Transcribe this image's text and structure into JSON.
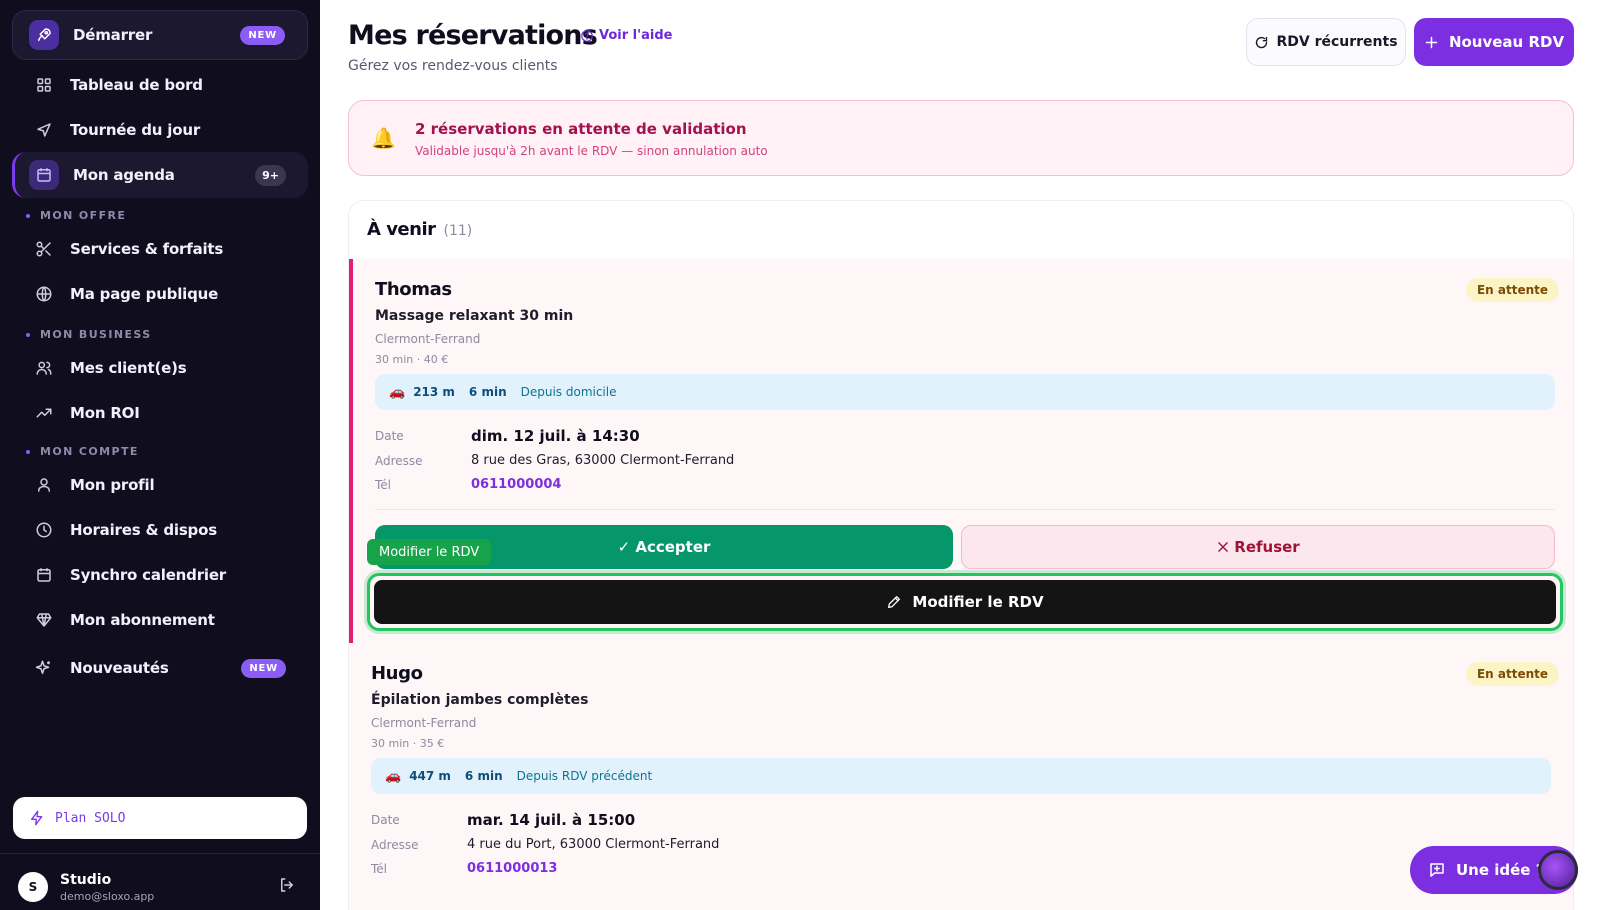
{
  "sidebar": {
    "start": {
      "label": "Démarrer",
      "badge": "NEW"
    },
    "items": [
      {
        "label": "Tableau de bord"
      },
      {
        "label": "Tournée du jour"
      },
      {
        "label": "Mon agenda",
        "badge": "9+"
      }
    ],
    "sections": {
      "offre": {
        "title": "MON OFFRE",
        "items": [
          "Services & forfaits",
          "Ma page publique"
        ]
      },
      "business": {
        "title": "MON BUSINESS",
        "items": [
          "Mes client(e)s",
          "Mon ROI"
        ]
      },
      "compte": {
        "title": "MON COMPTE",
        "items": [
          "Mon profil",
          "Horaires & dispos",
          "Synchro calendrier",
          "Mon abonnement"
        ]
      }
    },
    "news": {
      "label": "Nouveautés",
      "badge": "NEW"
    },
    "plan": "Plan SOLO",
    "user": {
      "initial": "S",
      "name": "Studio",
      "email": "demo@sloxo.app"
    }
  },
  "header": {
    "title": "Mes réservations",
    "help": "Voir l'aide",
    "subtitle": "Gérez vos rendez-vous clients",
    "recurrent_button": "RDV récurrents",
    "new_button": "Nouveau RDV"
  },
  "alert": {
    "title": "2 réservations en attente de validation",
    "subtitle": "Validable jusqu'à 2h avant le RDV — sinon annulation auto"
  },
  "upcoming": {
    "title": "À venir",
    "count": "(11)",
    "labels": {
      "date": "Date",
      "address": "Adresse",
      "tel": "Tél"
    },
    "bookings": [
      {
        "name": "Thomas",
        "service": "Massage relaxant 30 min",
        "city": "Clermont-Ferrand",
        "meta": "30 min · 40 €",
        "status": "En attente",
        "distance": "213 m",
        "duration": "6 min",
        "from": "Depuis domicile",
        "date": "dim. 12 juil. à 14:30",
        "address": "8 rue des Gras, 63000 Clermont-Ferrand",
        "tel": "0611000004"
      },
      {
        "name": "Hugo",
        "service": "Épilation jambes complètes",
        "city": "Clermont-Ferrand",
        "meta": "30 min · 35 €",
        "status": "En attente",
        "distance": "447 m",
        "duration": "6 min",
        "from": "Depuis RDV précédent",
        "date": "mar. 14 juil. à 15:00",
        "address": "4 rue du Port, 63000 Clermont-Ferrand",
        "tel": "0611000013"
      }
    ],
    "actions": {
      "accept": "✓ Accepter",
      "refuse": "Refuser",
      "edit": "Modifier le RDV",
      "tooltip": "Modifier le RDV"
    }
  },
  "fab": {
    "label": "Une idée ?"
  }
}
